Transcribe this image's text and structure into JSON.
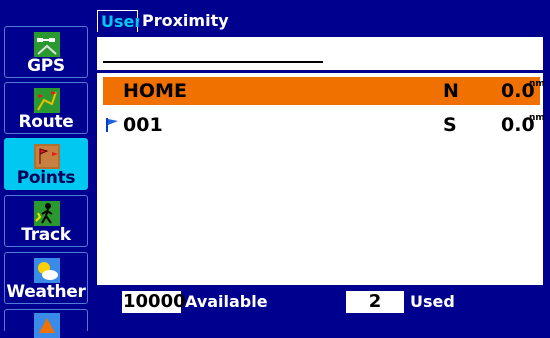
{
  "nav": {
    "items": [
      {
        "label": "GPS",
        "icon": "gps-satellite-icon"
      },
      {
        "label": "Route",
        "icon": "route-flags-icon"
      },
      {
        "label": "Points",
        "icon": "points-flags-icon",
        "active": true
      },
      {
        "label": "Track",
        "icon": "track-hiker-icon"
      },
      {
        "label": "Weather",
        "icon": "weather-sun-cloud-icon"
      },
      {
        "label": "",
        "icon": "partial-next-icon"
      }
    ]
  },
  "tabs": [
    {
      "label": "User",
      "active": true
    },
    {
      "label": "Proximity",
      "active": false
    }
  ],
  "search": {
    "value": ""
  },
  "waypoints": [
    {
      "name": "HOME",
      "direction": "N",
      "distance": "0.0",
      "unit": "nm",
      "selected": true,
      "flag": false
    },
    {
      "name": "001",
      "direction": "S",
      "distance": "0.0",
      "unit": "nm",
      "selected": false,
      "flag": true
    }
  ],
  "footer": {
    "available_count": "10000",
    "available_label": "Available",
    "used_count": "2",
    "used_label": "Used"
  },
  "colors": {
    "background": "#00008e",
    "active_tab_text": "#00c8f0",
    "active_nav": "#00c8f0",
    "selection": "#f07000",
    "panel": "#ffffff"
  }
}
